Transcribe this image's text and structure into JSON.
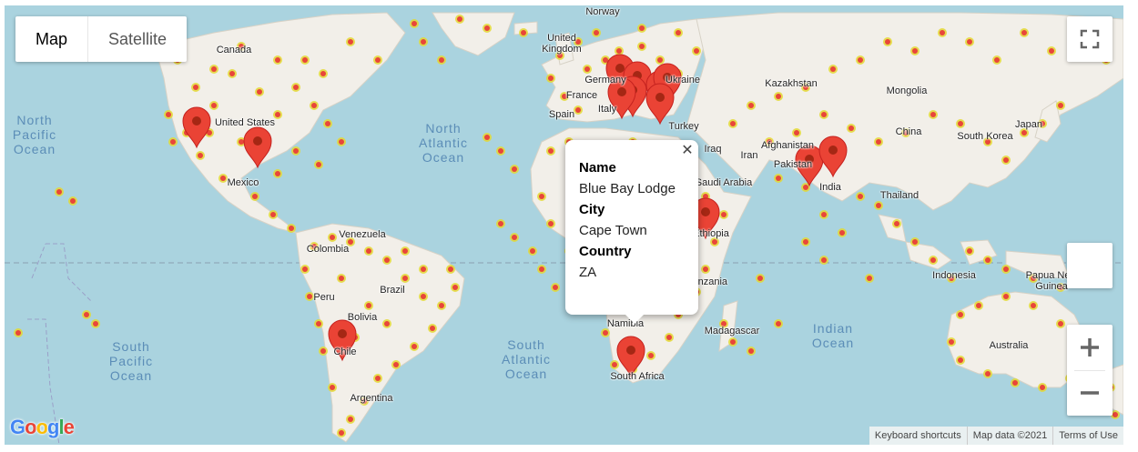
{
  "map_type": {
    "map_label": "Map",
    "satellite_label": "Satellite"
  },
  "fullscreen_icon": "fullscreen-icon",
  "zoom": {
    "in_icon": "zoom-in-icon",
    "out_icon": "zoom-out-icon"
  },
  "popup": {
    "name_label": "Name",
    "name_value": "Blue Bay Lodge",
    "city_label": "City",
    "city_value": "Cape Town",
    "country_label": "Country",
    "country_value": "ZA",
    "close_icon": "close-icon"
  },
  "attribution": {
    "shortcuts": "Keyboard shortcuts",
    "map_data": "Map data ©2021",
    "terms": "Terms of Use"
  },
  "logo": {
    "G": "G",
    "o1": "o",
    "o2": "o",
    "g": "g",
    "l": "l",
    "e": "e"
  },
  "labels": {
    "norway": "Norway",
    "uk": "United\nKingdom",
    "canada": "Canada",
    "united_states": "United States",
    "mexico": "Mexico",
    "germany": "Germany",
    "france": "France",
    "spain": "Spain",
    "italy": "Italy",
    "turkey": "Turkey",
    "ukraine": "Ukraine",
    "kazakhstan": "Kazakhstan",
    "mongolia": "Mongolia",
    "china": "China",
    "japan": "Japan",
    "south_korea": "South Korea",
    "iraq": "Iraq",
    "iran": "Iran",
    "afghanistan": "Afghanistan",
    "pakistan": "Pakistan",
    "india": "India",
    "saudi_arabia": "Saudi Arabia",
    "thailand": "Thailand",
    "ethiopia": "Ethiopia",
    "tanzania": "Tanzania",
    "indonesia": "Indonesia",
    "papua_new_guinea": "Papua New\nGuinea",
    "venezuela": "Venezuela",
    "colombia": "Colombia",
    "brazil": "Brazil",
    "peru": "Peru",
    "bolivia": "Bolivia",
    "chile": "Chile",
    "argentina": "Argentina",
    "namibia": "Namibia",
    "madagascar": "Madagascar",
    "south_africa": "South Africa",
    "australia": "Australia"
  },
  "oceans": {
    "north_pacific": "North\nPacific\nOcean",
    "north_atlantic": "North\nAtlantic\nOcean",
    "south_pacific": "South\nPacific\nOcean",
    "south_atlantic": "South\nAtlantic\nOcean",
    "indian": "Indian\nOcean"
  },
  "colors": {
    "water": "#aad3df",
    "land": "#f2efe9",
    "heat_red": "#e8463a",
    "heat_yellow": "#e4d832",
    "marker": "#ea4335",
    "marker_dot": "#a52714"
  }
}
